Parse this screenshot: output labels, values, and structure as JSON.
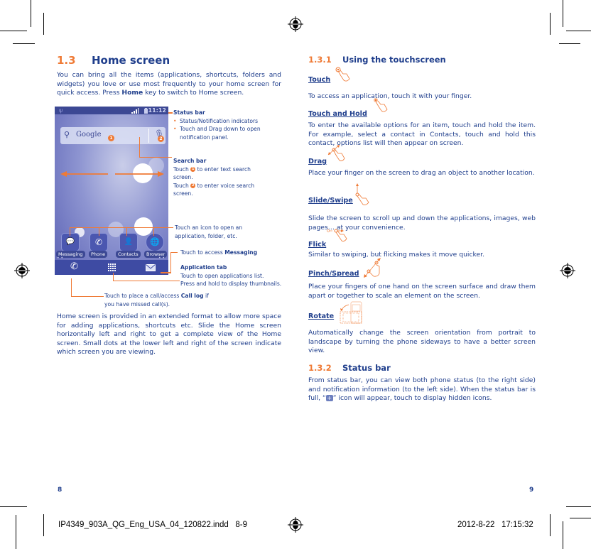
{
  "left_page": {
    "section_number": "1.3",
    "section_title": "Home screen",
    "intro_text_1": "You can bring all the items (applications, shortcuts, folders and widgets) you love or use most frequently to your home screen for quick access. Press ",
    "intro_bold": "Home",
    "intro_text_2": " key to switch to Home screen.",
    "phone_screen": {
      "time": "11:12",
      "search_placeholder": "Google",
      "badge_1": "1",
      "badge_2": "2",
      "apps": [
        "Messaging",
        "Phone",
        "Contacts",
        "Browser"
      ]
    },
    "callouts": {
      "status_bar_title": "Status bar",
      "status_bar_bullets": [
        "Status/Notification indicators",
        "Touch and Drag down to open notification panel."
      ],
      "search_bar_title": "Search bar",
      "search_bar_line1_a": "Touch ",
      "search_bar_line1_b": " to enter text search screen.",
      "search_bar_line2_a": "Touch ",
      "search_bar_line2_b": " to enter voice search screen.",
      "icon_text": "Touch an icon to open an application, folder, etc.",
      "messaging_text": "Touch to access ",
      "messaging_bold": "Messaging",
      "app_tab_title": "Application tab",
      "app_tab_line1": "Touch to open applications list.",
      "app_tab_line2": "Press and hold to display thumbnails.",
      "call_text_a": "Touch to place a call/access ",
      "call_bold": "Call log",
      "call_text_b": " if",
      "call_text_c": "you have missed call(s)."
    },
    "body_text": "Home screen is provided in an extended format to allow more space for adding applications, shortcuts etc. Slide the Home screen horizontally left and right to get a complete view of the Home screen. Small dots at the lower left and right of the screen indicate which screen you are viewing.",
    "page_number": "8"
  },
  "right_page": {
    "subsection_1_number": "1.3.1",
    "subsection_1_title": "Using the touchscreen",
    "gestures": [
      {
        "title": "Touch",
        "icon": "touch-gesture-icon",
        "text": "To access an application, touch it with your finger."
      },
      {
        "title": "Touch and Hold",
        "icon": "touch-hold-gesture-icon",
        "text": "To enter the available options for an item, touch and hold the item. For example, select a contact in Contacts, touch and hold this contact, options list will then appear on screen."
      },
      {
        "title": "Drag",
        "icon": "drag-gesture-icon",
        "text": "Place your finger on the screen to drag an object to another location."
      },
      {
        "title": "Slide/Swipe",
        "icon": "swipe-gesture-icon",
        "text": "Slide the screen to scroll up and down the applications, images, web pages… at your convenience."
      },
      {
        "title": "Flick",
        "icon": "flick-gesture-icon",
        "text": "Similar to swiping, but flicking makes it move quicker."
      },
      {
        "title": "Pinch/Spread",
        "icon": "pinch-gesture-icon",
        "text": "Place your fingers of one hand on the screen surface and draw them apart or together to scale an element on the screen."
      },
      {
        "title": "Rotate",
        "icon": "rotate-gesture-icon",
        "text": "Automatically change the screen orientation from portrait to landscape by turning the phone sideways to have a better screen view."
      }
    ],
    "subsection_2_number": "1.3.2",
    "subsection_2_title": "Status bar",
    "status_text_1": "From status bar, you can view both phone status (to the right side) and notification information (to the left side). When the status bar is full, “",
    "status_text_2": "” icon will appear, touch to display hidden icons.",
    "page_number": "9"
  },
  "print_slug": {
    "filename": "IP4349_903A_QG_Eng_USA_04_120822.indd   8-9",
    "timestamp": "2012-8-22   17:15:32"
  },
  "colors": {
    "text_blue": "#1f3e8c",
    "accent_orange": "#ef7a35"
  }
}
